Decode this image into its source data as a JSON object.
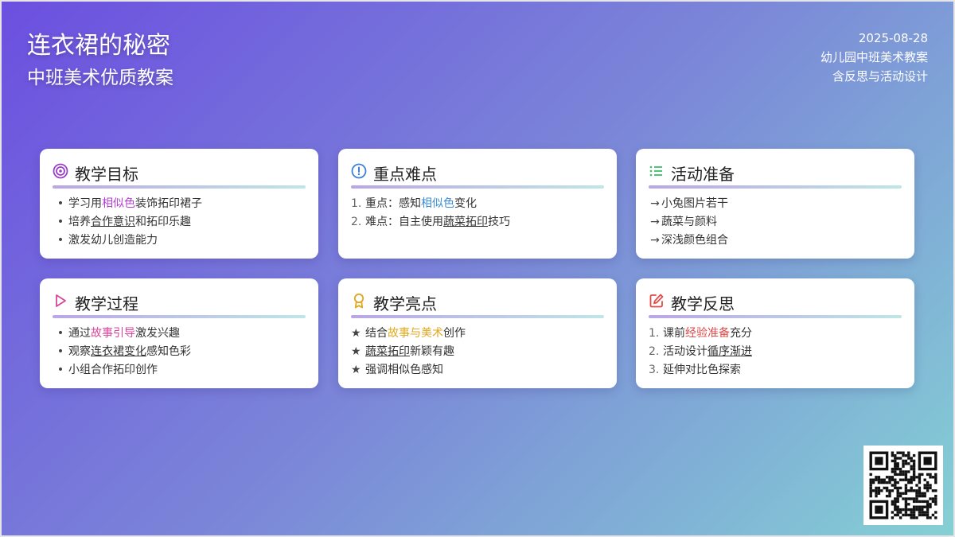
{
  "header": {
    "title": "连衣裙的秘密",
    "subtitle": "中班美术优质教案",
    "date": "2025-08-28",
    "meta_line_1": "幼儿园中班美术教案",
    "meta_line_2": "含反思与活动设计"
  },
  "cards": [
    {
      "title": "教学目标",
      "icon": "target-icon",
      "items": [
        {
          "p1": "学习用",
          "hl": "相似色",
          "p2": "装饰拓印裙子"
        },
        {
          "p1": "培养",
          "hl": "合作意识",
          "p2": "和拓印乐趣"
        },
        {
          "p1": "激发幼儿创造能力",
          "hl": "",
          "p2": ""
        }
      ]
    },
    {
      "title": "重点难点",
      "icon": "exclamation-circle-icon",
      "items": [
        {
          "num": "1.",
          "p1": "重点：感知",
          "hl": "相似色",
          "p2": "变化"
        },
        {
          "num": "2.",
          "p1": "难点：自主使用",
          "hl": "蔬菜拓印",
          "p2": "技巧"
        }
      ]
    },
    {
      "title": "活动准备",
      "icon": "list-icon",
      "items": [
        {
          "p1": "小兔图片若干"
        },
        {
          "p1": "蔬菜与颜料"
        },
        {
          "p1": "深浅颜色组合"
        }
      ]
    },
    {
      "title": "教学过程",
      "icon": "play-icon",
      "items": [
        {
          "p1": "通过",
          "hl": "故事引导",
          "p2": "激发兴趣"
        },
        {
          "p1": "观察",
          "hl": "连衣裙变化",
          "p2": "感知色彩"
        },
        {
          "p1": "小组合作拓印创作",
          "hl": "",
          "p2": ""
        }
      ]
    },
    {
      "title": "教学亮点",
      "icon": "award-icon",
      "items": [
        {
          "p1": "结合",
          "hl": "故事与美术",
          "p2": "创作"
        },
        {
          "p1": "",
          "hl": "蔬菜拓印",
          "p2": "新颖有趣"
        },
        {
          "p1": "强调相似色感知",
          "hl": "",
          "p2": ""
        }
      ]
    },
    {
      "title": "教学反思",
      "icon": "edit-icon",
      "items": [
        {
          "num": "1.",
          "p1": "课前",
          "hl": "经验准备",
          "p2": "充分"
        },
        {
          "num": "2.",
          "p1": "活动设计",
          "hl": "循序渐进",
          "p2": ""
        },
        {
          "num": "3.",
          "p1": "延伸对比色探索",
          "hl": "",
          "p2": ""
        }
      ]
    }
  ],
  "markers": {
    "bullet": "•",
    "arrow": "→",
    "star": "★"
  },
  "colors": {
    "purple_icon": "#9b3fc8",
    "blue_icon": "#3c7fd6",
    "green_icon": "#3cbf6c",
    "pink_icon": "#d9459a",
    "yellow_icon": "#e0a81c",
    "red_icon": "#e24a4a"
  }
}
